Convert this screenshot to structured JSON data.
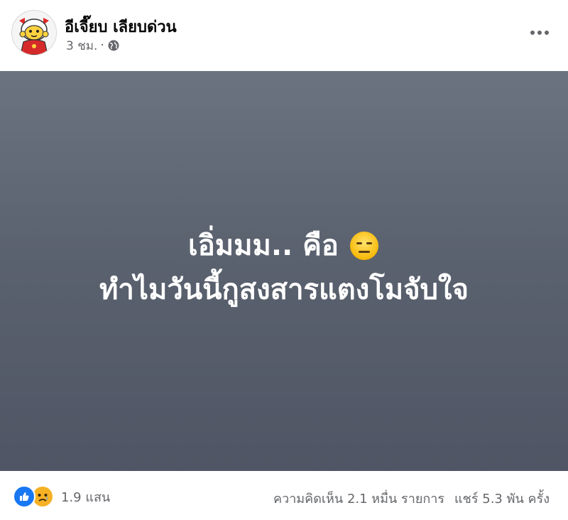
{
  "post": {
    "author": "อีเจี๊ยบ เลียบด่วน",
    "time": "3 ชม.",
    "separator": "·",
    "privacy_icon": "globe-icon",
    "more_icon": "more-horizontal-icon",
    "text_line1": "เอิ่มมม.. คือ",
    "text_line1_emoji": "expressionless-face-emoji",
    "text_line2": "ทำไมวันนี้กูสงสารแตงโมจับใจ",
    "background_colors": [
      "#6b7380",
      "#4f5564"
    ]
  },
  "footer": {
    "reaction_icons": [
      "like-icon",
      "sad-icon"
    ],
    "reaction_count": "1.9 แสน",
    "comments": "ความคิดเห็น 2.1 หมื่น รายการ",
    "shares": "แชร์ 5.3 พัน ครั้ง"
  },
  "colors": {
    "like": "#1877f2",
    "sad": "#f7b125",
    "meta_text": "#65676b"
  }
}
